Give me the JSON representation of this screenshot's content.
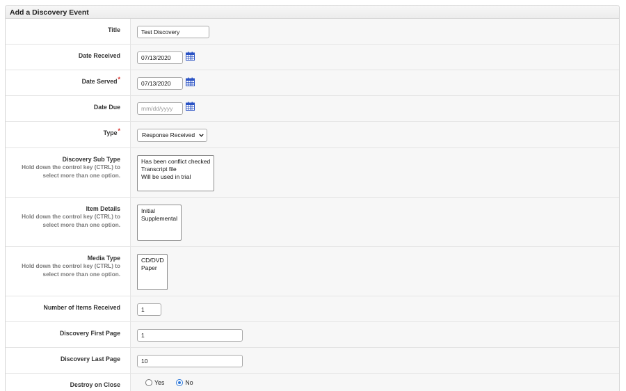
{
  "panel": {
    "title": "Add a Discovery Event"
  },
  "fields": {
    "title": {
      "label": "Title",
      "value": "Test Discovery"
    },
    "date_received": {
      "label": "Date Received",
      "value": "07/13/2020"
    },
    "date_served": {
      "label": "Date Served",
      "required_mark": "*",
      "value": "07/13/2020"
    },
    "date_due": {
      "label": "Date Due",
      "value": "",
      "placeholder": "mm/dd/yyyy"
    },
    "type": {
      "label": "Type",
      "required_mark": "*",
      "selected": "Response Received"
    },
    "discovery_sub_type": {
      "label": "Discovery Sub Type",
      "hint": "Hold down the control key (CTRL) to select more than one option.",
      "options": [
        "Has been conflict checked",
        "Transcript file",
        "Will be used in trial"
      ]
    },
    "item_details": {
      "label": "Item Details",
      "hint": "Hold down the control key (CTRL) to select more than one option.",
      "options": [
        "Initial",
        "Supplemental"
      ]
    },
    "media_type": {
      "label": "Media Type",
      "hint": "Hold down the control key (CTRL) to select more than one option.",
      "options": [
        "CD/DVD",
        "Paper"
      ]
    },
    "number_of_items_received": {
      "label": "Number of Items Received",
      "value": "1"
    },
    "discovery_first_page": {
      "label": "Discovery First Page",
      "value": "1"
    },
    "discovery_last_page": {
      "label": "Discovery Last Page",
      "value": "10"
    },
    "destroy_on_close": {
      "label": "Destroy on Close",
      "options": [
        "Yes",
        "No"
      ],
      "selected": "No"
    }
  },
  "icons": {
    "calendar": "calendar-icon",
    "select_caret": "chevron-down-icon"
  },
  "colors": {
    "required": "#d9302c",
    "calendar": "#2b53c4",
    "radio_selected": "#2f78d8"
  }
}
